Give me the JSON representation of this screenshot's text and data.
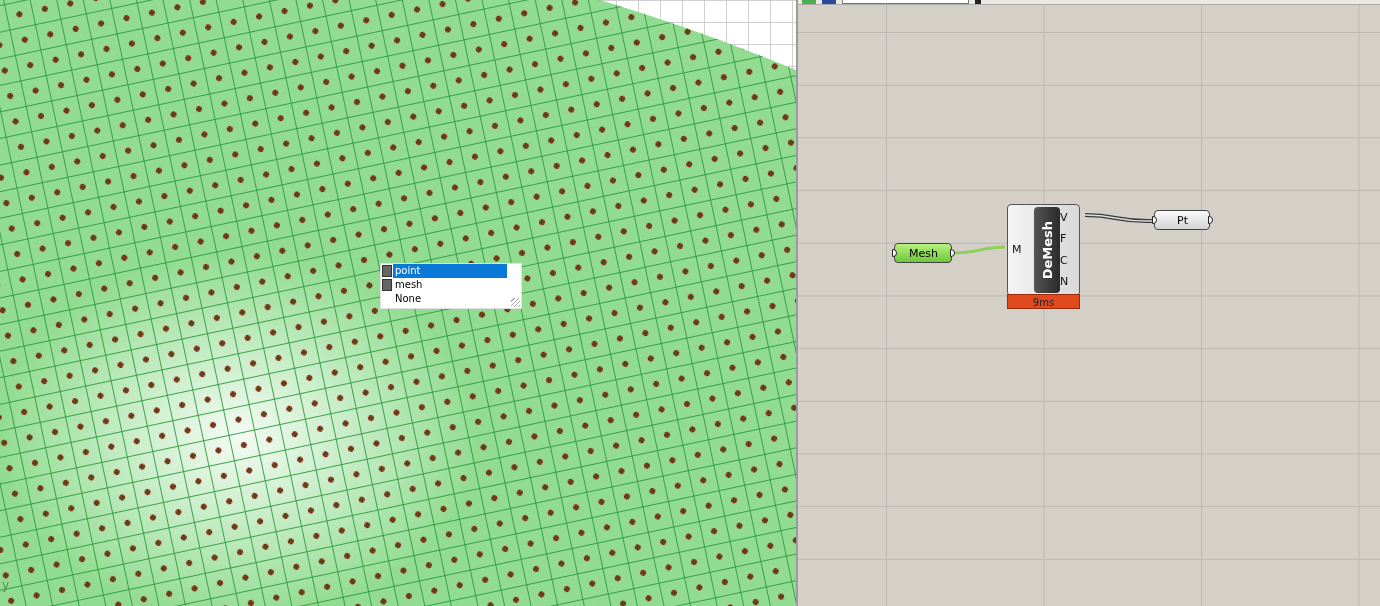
{
  "viewport": {
    "axis_label": "y",
    "popup": {
      "items": [
        {
          "label": "point",
          "kind": "swatch",
          "selected": true
        },
        {
          "label": "mesh",
          "kind": "swatch",
          "selected": false
        },
        {
          "label": "None",
          "kind": "plain",
          "selected": false
        }
      ]
    }
  },
  "canvas": {
    "mesh_param": {
      "label": "Mesh"
    },
    "component": {
      "name": "DeMesh",
      "inputs": [
        "M"
      ],
      "outputs": [
        "V",
        "F",
        "C",
        "N"
      ],
      "timing": "9ms"
    },
    "pt_param": {
      "label": "Pt"
    }
  }
}
